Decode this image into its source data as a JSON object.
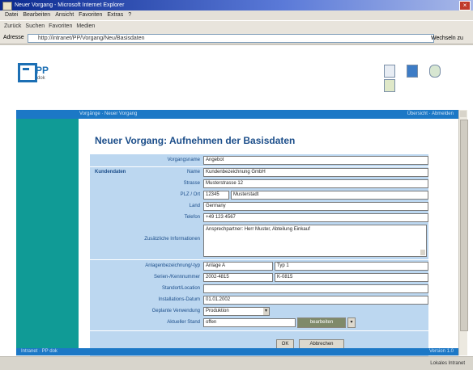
{
  "window": {
    "title": "Neuer Vorgang - Microsoft Internet Explorer",
    "close_label": "×"
  },
  "menubar": {
    "items": [
      "Datei",
      "Bearbeiten",
      "Ansicht",
      "Favoriten",
      "Extras",
      "?"
    ]
  },
  "toolbar": {
    "items": [
      "Zurück",
      "Suchen",
      "Favoriten",
      "Medien"
    ]
  },
  "addressbar": {
    "label": "Adresse",
    "url": "http://intranet/PP/Vorgang/Neu/Basisdaten",
    "go_label": "Wechseln zu"
  },
  "header": {
    "logo_text": "PP",
    "logo_sub": "dok"
  },
  "navbar": {
    "left": "Vorgänge · Neuer Vorgang",
    "right": "Übersicht · Abmelden"
  },
  "page": {
    "heading": "Neuer Vorgang: Aufnehmen der Basisdaten"
  },
  "form": {
    "vorgangsname": {
      "label": "Vorgangsname",
      "value": "Angebot"
    },
    "kundendaten": {
      "section": "Kundendaten",
      "name": {
        "label": "Name",
        "value": "Kundenbezeichnung GmbH"
      },
      "strasse": {
        "label": "Strasse",
        "value": "Musterstrasse 12"
      },
      "plz_ort": {
        "label": "PLZ / Ort",
        "plz": "12345",
        "ort": "Musterstadt"
      },
      "land": {
        "label": "Land",
        "value": "Germany"
      },
      "telefon": {
        "label": "Telefon",
        "value": "+49 123 4567"
      },
      "zusatz": {
        "label": "Zusätzliche Informationen",
        "value": "Ansprechpartner: Herr Muster, Abteilung Einkauf"
      }
    },
    "anlagen": {
      "label": "Anlagenbezeichnung/-typ",
      "value1": "Anlage A",
      "value2": "Typ 1"
    },
    "serien": {
      "label": "Serien-/Kennnummer",
      "value1": "2002-4815",
      "value2": "K-0815"
    },
    "location": {
      "label": "Standort/Location",
      "value": ""
    },
    "installation": {
      "label": "Installations-Datum",
      "value": "01.01.2002"
    },
    "verwendung": {
      "label": "Geplante Verwendung",
      "value": "Produktion"
    },
    "aktuell": {
      "label": "Aktueller Stand",
      "value": "offen",
      "button": "bearbeiten"
    },
    "ok_button": "OK",
    "cancel_button": "Abbrechen"
  },
  "footer": {
    "left": "Intranet · PP dok",
    "right": "Version 1.0"
  },
  "statusbar": {
    "right": "Lokales Intranet"
  }
}
